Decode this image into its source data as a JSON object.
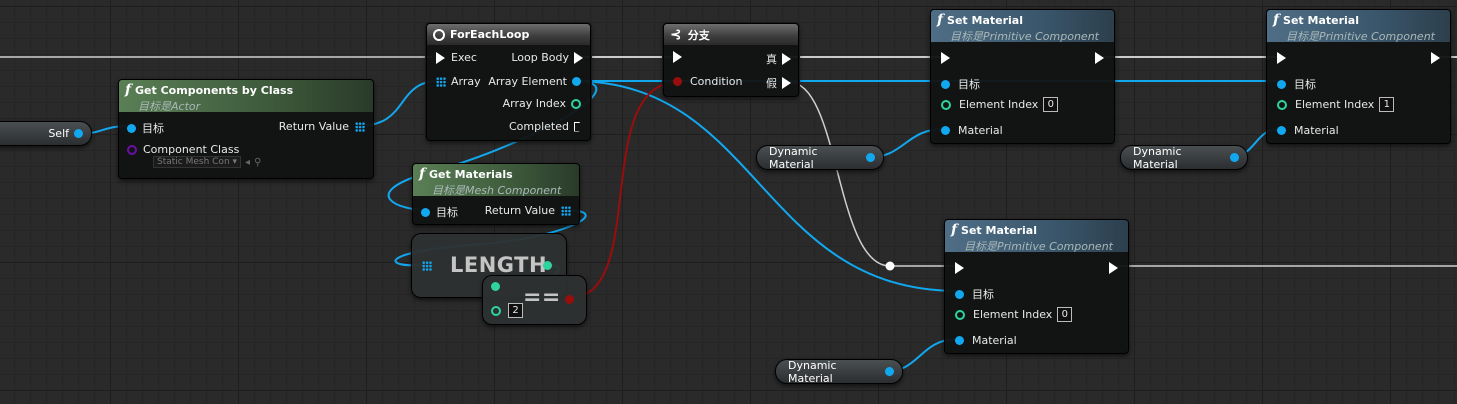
{
  "self": {
    "label": "Self"
  },
  "get_components": {
    "title": "Get Components by Class",
    "subtitle": "目标是Actor",
    "pin_target": "目标",
    "pin_return": "Return Value",
    "pin_component_class": "Component Class",
    "component_class_value": "Static Mesh Con",
    "dropdown_icon": "chevron-down-icon",
    "browse_icon": "arrow-left-icon",
    "search_icon": "search-icon"
  },
  "foreach": {
    "title": "ForEachLoop",
    "pin_exec": "Exec",
    "pin_array": "Array",
    "pin_loop_body": "Loop Body",
    "pin_array_element": "Array Element",
    "pin_array_index": "Array Index",
    "pin_completed": "Completed"
  },
  "branch": {
    "title": "分支",
    "pin_condition": "Condition",
    "pin_true": "真",
    "pin_false": "假"
  },
  "get_materials": {
    "title": "Get Materials",
    "subtitle": "目标是Mesh Component",
    "pin_target": "目标",
    "pin_return": "Return Value"
  },
  "length": {
    "label": "LENGTH"
  },
  "equals": {
    "label": "==",
    "value": "2"
  },
  "set_material_1": {
    "title": "Set Material",
    "subtitle": "目标是Primitive Component",
    "pin_target": "目标",
    "pin_element_index": "Element Index",
    "element_index_value": "0",
    "pin_material": "Material"
  },
  "set_material_2": {
    "title": "Set Material",
    "subtitle": "目标是Primitive Component",
    "pin_target": "目标",
    "pin_element_index": "Element Index",
    "element_index_value": "1",
    "pin_material": "Material"
  },
  "set_material_3": {
    "title": "Set Material",
    "subtitle": "目标是Primitive Component",
    "pin_target": "目标",
    "pin_element_index": "Element Index",
    "element_index_value": "0",
    "pin_material": "Material"
  },
  "dyn_mat_1": {
    "label": "Dynamic Material"
  },
  "dyn_mat_2": {
    "label": "Dynamic Material"
  },
  "dyn_mat_3": {
    "label": "Dynamic Material"
  },
  "colors": {
    "exec_wire": "#ffffff",
    "object_pin": "#12a8f0",
    "int_pin": "#2ed3a0",
    "bool_pin": "#9a0d0d",
    "class_pin": "#6a0fa8",
    "function_header": "#3a566b",
    "pure_header": "#3d5a3b"
  }
}
